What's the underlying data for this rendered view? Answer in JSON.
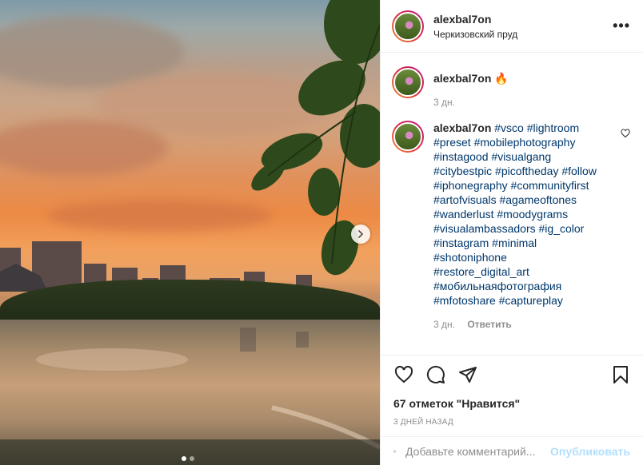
{
  "post": {
    "username": "alexbal7on",
    "location": "Черкизовский пруд",
    "photo_alt": "Sunset over pond with bridge"
  },
  "caption_comment": {
    "username": "alexbal7on",
    "emoji": "🔥",
    "time": "3 дн."
  },
  "hashtag_comment": {
    "username": "alexbal7on",
    "lines": [
      "#vsco #lightroom",
      "#preset #mobilephotography",
      "#instagood #visualgang",
      "#citybestpic #picoftheday #follow",
      "#iphonegraphy #communityfirst",
      "#artofvisuals #agameoftones",
      "#wanderlust #moodygrams",
      "#visualambassadors #ig_color",
      "#instagram #minimal",
      "#shotoniphone",
      "#restore_digital_art",
      "#мобильнаяфотография",
      "#mfotoshare #captureplay"
    ],
    "time": "3 дн.",
    "reply_label": "Ответить"
  },
  "likes_text": "67 отметок \"Нравится\"",
  "timestamp": "3 дней назад",
  "comment_input": {
    "placeholder": "Добавьте комментарий...",
    "publish_label": "Опубликовать"
  },
  "carousel": {
    "total": 2,
    "active": 1
  },
  "colors": {
    "link": "#00376b",
    "publish": "#b2dffc",
    "muted": "#8e8e8e"
  }
}
